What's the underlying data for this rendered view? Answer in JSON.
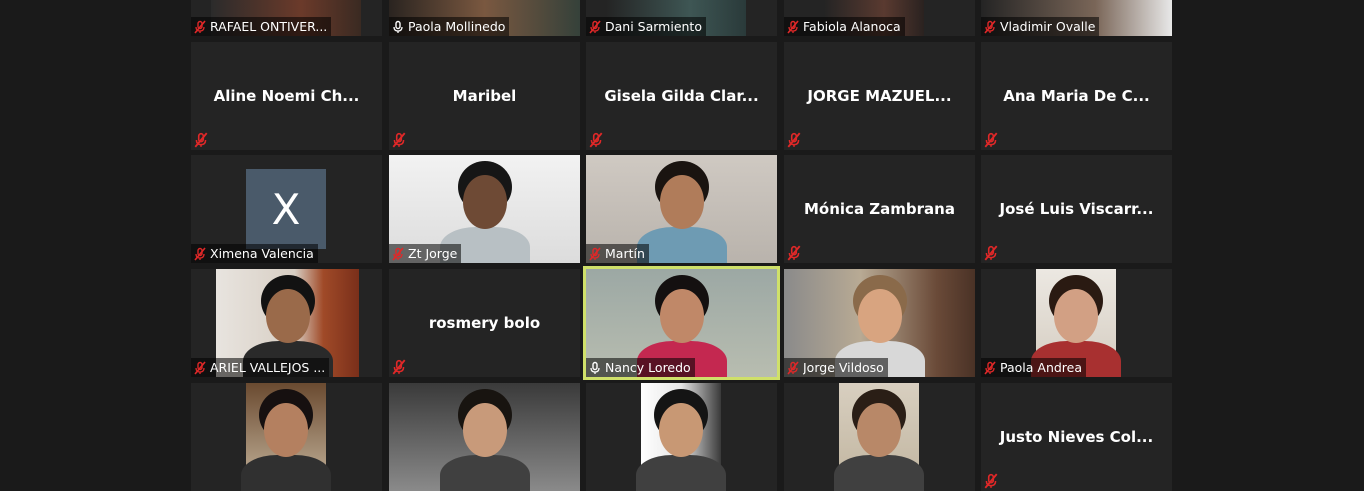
{
  "meeting": {
    "participants": [
      {
        "name": "RAFAEL ONTIVER...",
        "muted": true,
        "video": "partial"
      },
      {
        "name": "Paola Mollinedo",
        "muted": false,
        "video": "partial"
      },
      {
        "name": "Dani Sarmiento",
        "muted": true,
        "video": "partial"
      },
      {
        "name": "Fabiola Alanoca",
        "muted": true,
        "video": "partial"
      },
      {
        "name": "Vladimir Ovalle",
        "muted": true,
        "video": "partial"
      },
      {
        "name": "Aline Noemi Ch...",
        "muted": true,
        "video": "off"
      },
      {
        "name": "Maribel",
        "muted": true,
        "video": "off"
      },
      {
        "name": "Gisela Gilda Clar...",
        "muted": true,
        "video": "off"
      },
      {
        "name": "JORGE MAZUEL...",
        "muted": true,
        "video": "off"
      },
      {
        "name": "Ana Maria De C...",
        "muted": true,
        "video": "off"
      },
      {
        "name": "Ximena Valencia",
        "muted": true,
        "video": "avatar",
        "avatar_letter": "X"
      },
      {
        "name": "Zt Jorge",
        "muted": true,
        "video": "on"
      },
      {
        "name": "Martín",
        "muted": true,
        "video": "on"
      },
      {
        "name": "Mónica Zambrana",
        "muted": true,
        "video": "off"
      },
      {
        "name": "José Luis Viscarr...",
        "muted": true,
        "video": "off"
      },
      {
        "name": "ARIEL VALLEJOS ...",
        "muted": true,
        "video": "on"
      },
      {
        "name": "rosmery bolo",
        "muted": true,
        "video": "off"
      },
      {
        "name": "Nancy Loredo",
        "muted": false,
        "video": "on",
        "active_speaker": true
      },
      {
        "name": "Jorge Vildoso",
        "muted": true,
        "video": "on"
      },
      {
        "name": "Paola Andrea",
        "muted": true,
        "video": "on"
      },
      {
        "name": "",
        "muted": true,
        "video": "on"
      },
      {
        "name": "",
        "muted": true,
        "video": "on"
      },
      {
        "name": "",
        "muted": true,
        "video": "on"
      },
      {
        "name": "",
        "muted": true,
        "video": "on"
      },
      {
        "name": "Justo Nieves Col...",
        "muted": true,
        "video": "off"
      }
    ]
  },
  "colors": {
    "background": "#1a1a1a",
    "tile": "#242424",
    "active_border": "#cfe06a",
    "muted_icon": "#e02828"
  }
}
